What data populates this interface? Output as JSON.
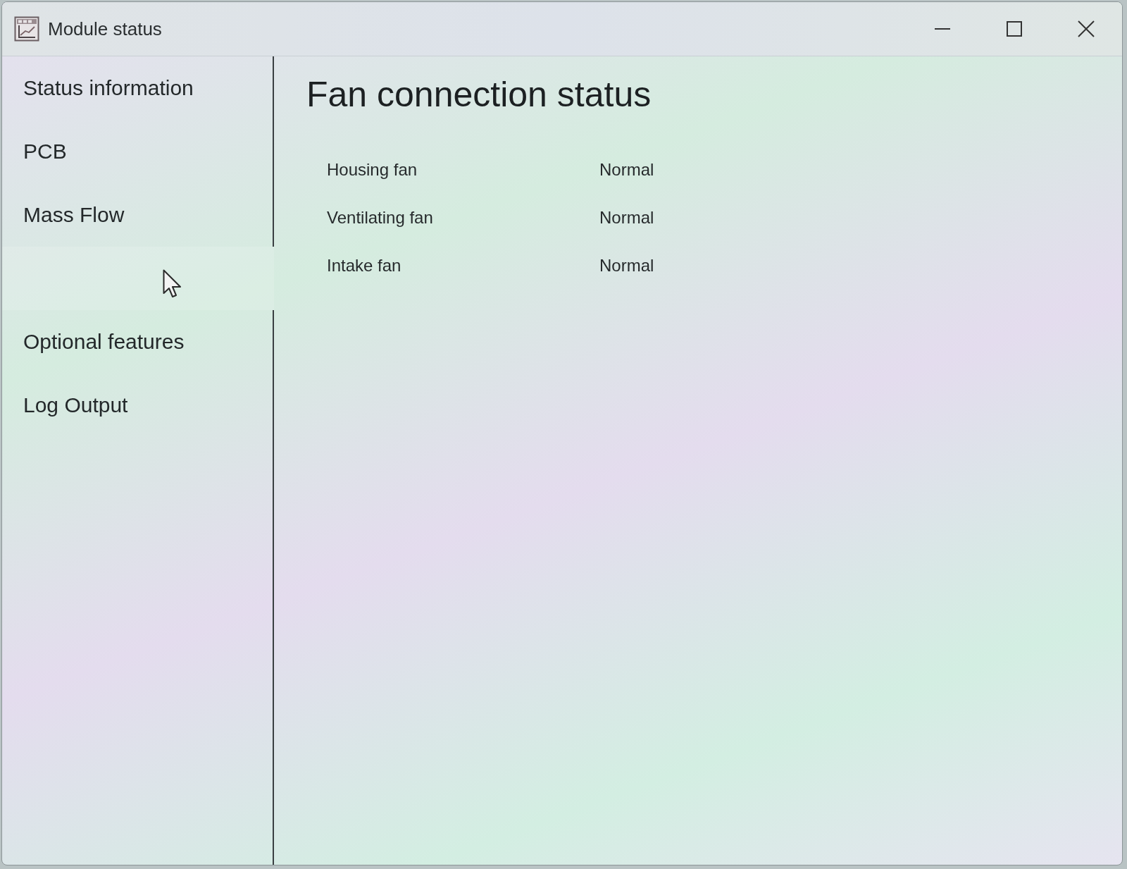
{
  "window": {
    "title": "Module status"
  },
  "sidebar": {
    "items": [
      {
        "label": "Status information",
        "selected": false
      },
      {
        "label": "PCB",
        "selected": false
      },
      {
        "label": "Mass Flow",
        "selected": false
      },
      {
        "selected": true
      },
      {
        "label": "Optional features",
        "selected": false
      },
      {
        "label": "Log Output",
        "selected": false
      }
    ]
  },
  "content": {
    "heading": "Fan connection status",
    "rows": [
      {
        "name": "Housing fan",
        "status": "Normal"
      },
      {
        "name": "Ventilating fan",
        "status": "Normal"
      },
      {
        "name": "Intake fan",
        "status": "Normal"
      }
    ]
  }
}
